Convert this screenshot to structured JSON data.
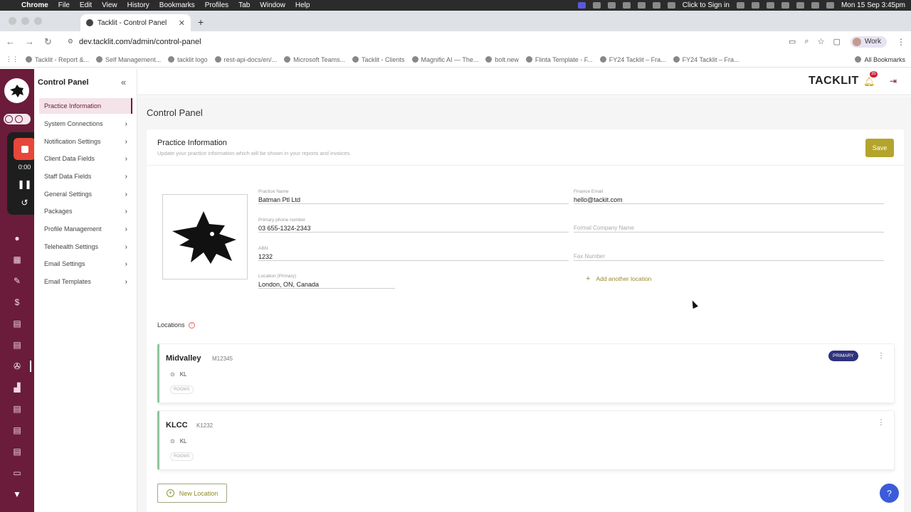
{
  "menubar": {
    "app": "Chrome",
    "items": [
      "File",
      "Edit",
      "View",
      "History",
      "Bookmarks",
      "Profiles",
      "Tab",
      "Window",
      "Help"
    ],
    "sign_in": "Click to Sign in",
    "datetime": "Mon 15 Sep  3:45pm"
  },
  "browser": {
    "tab_title": "Tacklit - Control Panel",
    "url": "dev.tacklit.com/admin/control-panel",
    "profile": "Work",
    "bookmarks": [
      "Tacklit - Report &...",
      "Self Management...",
      "tacklit logo",
      "rest-api-docs/en/...",
      "Microsoft Teams...",
      "Tacklit - Clients",
      "Magnific AI — The...",
      "bolt.new",
      "Flinta Template - F...",
      "FY24 Tacklit – Fra...",
      "FY24 Tacklit – Fra..."
    ],
    "all_bookmarks": "All Bookmarks"
  },
  "recorder": {
    "time": "0:00"
  },
  "sidebar": {
    "title": "Control Panel",
    "items": [
      {
        "label": "Practice Information"
      },
      {
        "label": "System Connections"
      },
      {
        "label": "Notification Settings"
      },
      {
        "label": "Client Data Fields"
      },
      {
        "label": "Staff Data Fields"
      },
      {
        "label": "General Settings"
      },
      {
        "label": "Packages"
      },
      {
        "label": "Profile Management"
      },
      {
        "label": "Telehealth Settings"
      },
      {
        "label": "Email Settings"
      },
      {
        "label": "Email Templates"
      }
    ]
  },
  "header": {
    "brand": "TACKLIT",
    "notification_count": "35"
  },
  "main": {
    "page_title": "Control Panel",
    "card_title": "Practice Information",
    "card_subtitle": "Update your practice information which will be shown in your reports and invoices.",
    "save_label": "Save",
    "fields": {
      "practice_name": {
        "label": "Practice Name",
        "value": "Batman Ptl Ltd"
      },
      "finance_email": {
        "label": "Finance Email",
        "value": "hello@tackit.com"
      },
      "phone": {
        "label": "Primary phone number",
        "value": "03 655-1324-2343"
      },
      "formal_company": {
        "placeholder": "Formal Company Name"
      },
      "abn": {
        "label": "ABN",
        "value": "1232"
      },
      "fax": {
        "placeholder": "Fax Number"
      },
      "location": {
        "label": "Location (Primary)",
        "value": "London, ON, Canada"
      }
    },
    "add_location": "Add another location",
    "locations_heading": "Locations",
    "locations": [
      {
        "name": "Midvalley",
        "code": "M12345",
        "city": "KL",
        "rooms": "ROOMS",
        "badge": "PRIMARY"
      },
      {
        "name": "KLCC",
        "code": "K1232",
        "city": "KL",
        "rooms": "ROOMS"
      }
    ],
    "new_location": "New Location"
  },
  "colors": {
    "rail": "#6b1c3a",
    "accent": "#b5a42b",
    "primary_badge": "#2f327d",
    "help": "#3b5bdb"
  }
}
